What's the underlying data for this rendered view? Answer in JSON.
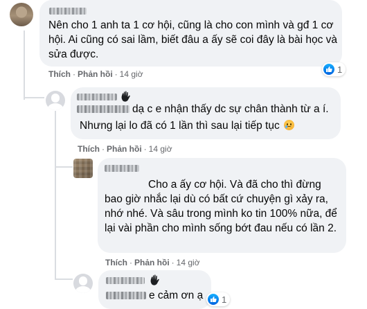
{
  "comments": [
    {
      "text": "Nên cho 1 anh ta 1 cơ hội, cũng là cho con mình và gđ 1 cơ hội. Ai cũng có sai lầm, biết đâu a ấy sẽ coi đây là bài học và sửa được.",
      "like_label": "Thích",
      "reply_label": "Phản hồi",
      "time": "14 giờ",
      "reaction_count": "1"
    },
    {
      "text_line1": "dạ c e nhận thấy dc sự chân thành từ a í.",
      "text_line2": "Nhưng lại lo đã có 1 lần thì sau lại tiếp tục",
      "like_label": "Thích",
      "reply_label": "Phản hồi",
      "time": "14 giờ"
    },
    {
      "text_line1": "Cho a ấy cơ hội. Và đã cho thì đừng",
      "text_rest": "bao giờ nhắc lại dù có bất cứ chuyện gì xảy ra, nhớ nhé. Và sâu trong mình ko tin 100% nữa, để lại vài phần cho mình sống bớt đau nếu có lần 2.",
      "like_label": "Thích",
      "reply_label": "Phản hồi",
      "time": "14 giờ"
    },
    {
      "text": "e cảm ơn ạ",
      "reaction_count": "1"
    }
  ],
  "colors": {
    "bubble": "#f0f2f5",
    "meta_text": "#65676b",
    "like_blue": "#0571ed"
  }
}
